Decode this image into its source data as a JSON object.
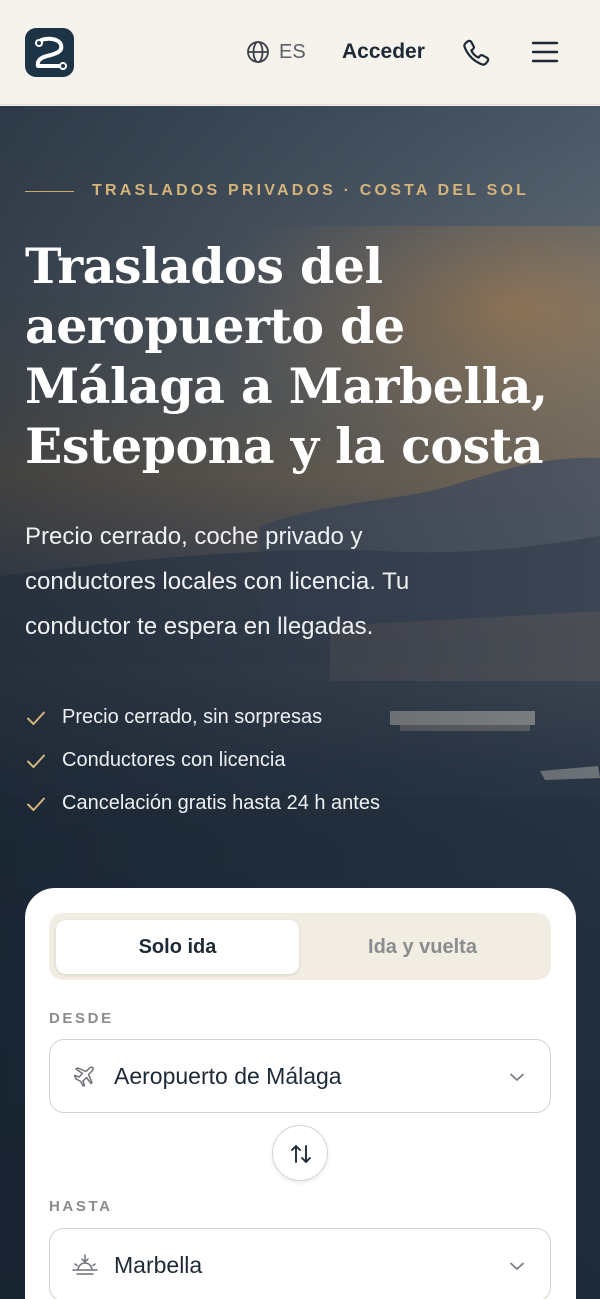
{
  "header": {
    "language": "ES",
    "login_label": "Acceder"
  },
  "hero": {
    "eyebrow": "TRASLADOS PRIVADOS · COSTA DEL SOL",
    "title_lines": [
      "Traslados del",
      "aeropuerto de",
      "Málaga a Marbella,",
      "Estepona y la costa"
    ],
    "subtitle_lines": [
      "Precio cerrado, coche privado y",
      "conductores locales con licencia. Tu",
      "conductor te espera en llegadas."
    ],
    "features": [
      "Precio cerrado, sin sorpresas",
      "Conductores con licencia",
      "Cancelación gratis hasta 24 h antes"
    ]
  },
  "booking": {
    "tabs": {
      "one_way": "Solo ida",
      "round_trip": "Ida y vuelta"
    },
    "from_label": "DESDE",
    "from_value": "Aeropuerto de Málaga",
    "to_label": "HASTA",
    "to_value": "Marbella"
  },
  "colors": {
    "accent_gold": "#d4b47a",
    "navy": "#1d3346",
    "page_bg": "#f6f3ec"
  },
  "icons": {
    "logo": "brand-logo-icon",
    "language": "globe-icon",
    "phone": "phone-icon",
    "menu": "hamburger-icon",
    "check": "check-icon",
    "from": "plane-icon",
    "to": "sunset-icon",
    "dropdown": "chevron-down-icon",
    "swap": "swap-arrows-icon"
  }
}
